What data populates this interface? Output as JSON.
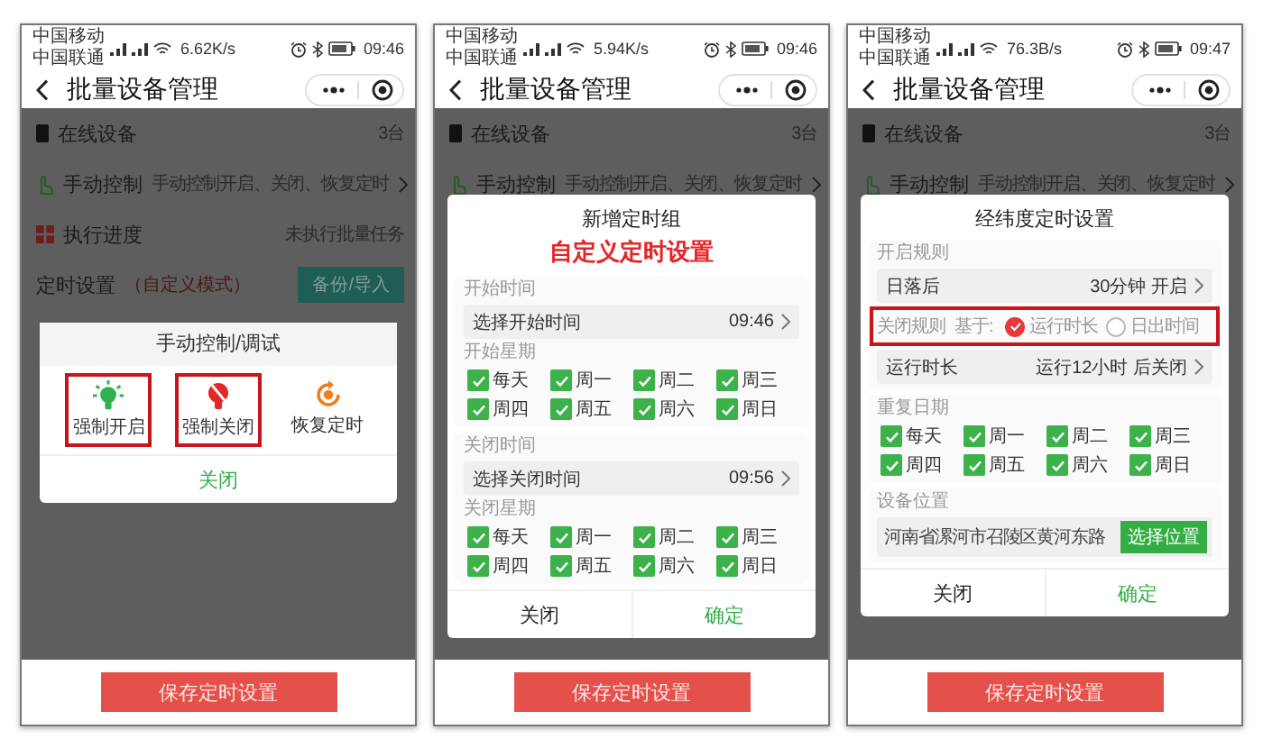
{
  "phones": [
    {
      "status": {
        "carriers": [
          "中国移动",
          "中国联通"
        ],
        "speed": "6.62K/s",
        "time": "09:46"
      },
      "nav": {
        "title": "批量设备管理"
      },
      "rows": [
        {
          "kind": "device",
          "label": "在线设备",
          "value": "3台"
        },
        {
          "kind": "manual",
          "label": "手动控制",
          "value": "手动控制开启、关闭、恢复定时"
        },
        {
          "kind": "progress",
          "label": "执行进度",
          "value": "未执行批量任务"
        },
        {
          "kind": "schedule",
          "label": "定时设置",
          "note": "（自定义模式）",
          "action": "备份/导入"
        }
      ],
      "modal": {
        "kind": "actions",
        "title": "手动控制/调试",
        "actions": [
          {
            "kind": "on",
            "label": "强制开启",
            "annotated": true
          },
          {
            "kind": "off",
            "label": "强制关闭",
            "annotated": true
          },
          {
            "kind": "restore",
            "label": "恢复定时",
            "annotated": false
          }
        ],
        "close": "关闭"
      },
      "save_button": "保存定时设置"
    },
    {
      "status": {
        "carriers": [
          "中国移动",
          "中国联通"
        ],
        "speed": "5.94K/s",
        "time": "09:46"
      },
      "nav": {
        "title": "批量设备管理"
      },
      "rows": [
        {
          "kind": "device",
          "label": "在线设备",
          "value": "3台"
        },
        {
          "kind": "manual",
          "label": "手动控制",
          "value": "手动控制开启、关闭、恢复定时"
        }
      ],
      "modal": {
        "kind": "form",
        "title": "新增定时组",
        "annotation": "自定义定时设置",
        "groups": [
          {
            "items": [
              {
                "kind": "caption",
                "text": "开始时间"
              },
              {
                "kind": "field",
                "label": "选择开始时间",
                "value": "09:46"
              },
              {
                "kind": "caption",
                "text": "开始星期"
              },
              {
                "kind": "days",
                "days": [
                  {
                    "label": "每天",
                    "checked": true
                  },
                  {
                    "label": "周一",
                    "checked": true
                  },
                  {
                    "label": "周二",
                    "checked": true
                  },
                  {
                    "label": "周三",
                    "checked": true
                  },
                  {
                    "label": "周四",
                    "checked": true
                  },
                  {
                    "label": "周五",
                    "checked": true
                  },
                  {
                    "label": "周六",
                    "checked": true
                  },
                  {
                    "label": "周日",
                    "checked": true
                  }
                ]
              }
            ]
          },
          {
            "items": [
              {
                "kind": "caption",
                "text": "关闭时间"
              },
              {
                "kind": "field",
                "label": "选择关闭时间",
                "value": "09:56"
              },
              {
                "kind": "caption",
                "text": "关闭星期"
              },
              {
                "kind": "days",
                "days": [
                  {
                    "label": "每天",
                    "checked": true
                  },
                  {
                    "label": "周一",
                    "checked": true
                  },
                  {
                    "label": "周二",
                    "checked": true
                  },
                  {
                    "label": "周三",
                    "checked": true
                  },
                  {
                    "label": "周四",
                    "checked": true
                  },
                  {
                    "label": "周五",
                    "checked": true
                  },
                  {
                    "label": "周六",
                    "checked": true
                  },
                  {
                    "label": "周日",
                    "checked": true
                  }
                ]
              }
            ]
          }
        ],
        "buttons": [
          {
            "kind": "cancel",
            "label": "关闭"
          },
          {
            "kind": "confirm",
            "label": "确定"
          }
        ]
      },
      "save_button": "保存定时设置"
    },
    {
      "status": {
        "carriers": [
          "中国移动",
          "中国联通"
        ],
        "speed": "76.3B/s",
        "time": "09:47"
      },
      "nav": {
        "title": "批量设备管理"
      },
      "rows": [
        {
          "kind": "device",
          "label": "在线设备",
          "value": "3台"
        },
        {
          "kind": "manual",
          "label": "手动控制",
          "value": "手动控制开启、关闭、恢复定时"
        }
      ],
      "modal": {
        "kind": "form",
        "title": "经纬度定时设置",
        "groups": [
          {
            "items": [
              {
                "kind": "caption",
                "text": "开启规则"
              },
              {
                "kind": "field",
                "label": "日落后",
                "value": "30分钟 开启"
              },
              {
                "kind": "rule",
                "label": "关闭规则",
                "prefix": "基于:",
                "annotated": true,
                "options": [
                  {
                    "label": "运行时长",
                    "selected": true
                  },
                  {
                    "label": "日出时间",
                    "selected": false
                  }
                ]
              },
              {
                "kind": "field",
                "label": "运行时长",
                "value": "运行12小时 后关闭"
              }
            ]
          },
          {
            "items": [
              {
                "kind": "caption",
                "text": "重复日期"
              },
              {
                "kind": "days",
                "days": [
                  {
                    "label": "每天",
                    "checked": true
                  },
                  {
                    "label": "周一",
                    "checked": true
                  },
                  {
                    "label": "周二",
                    "checked": true
                  },
                  {
                    "label": "周三",
                    "checked": true
                  },
                  {
                    "label": "周四",
                    "checked": true
                  },
                  {
                    "label": "周五",
                    "checked": true
                  },
                  {
                    "label": "周六",
                    "checked": true
                  },
                  {
                    "label": "周日",
                    "checked": true
                  }
                ]
              }
            ]
          },
          {
            "items": [
              {
                "kind": "caption",
                "text": "设备位置"
              },
              {
                "kind": "location",
                "text": "河南省漯河市召陵区黄河东路",
                "button": "选择位置"
              }
            ]
          }
        ],
        "buttons": [
          {
            "kind": "cancel",
            "label": "关闭"
          },
          {
            "kind": "confirm",
            "label": "确定"
          }
        ]
      },
      "save_button": "保存定时设置"
    }
  ]
}
